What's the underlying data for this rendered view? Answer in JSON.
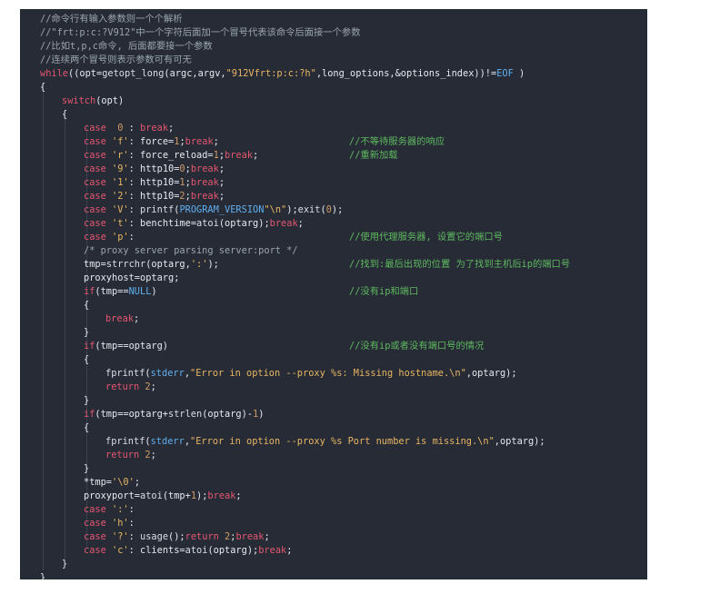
{
  "lines": [
    {
      "indent": 0,
      "tokens": [
        {
          "t": "//命令行有输入参数则一个个解析",
          "c": "cmt"
        }
      ]
    },
    {
      "indent": 0,
      "tokens": [
        {
          "t": "//\"frt:p:c:?V912\"中一个字符后面加一个冒号代表该命令后面接一个参数",
          "c": "cmt"
        }
      ]
    },
    {
      "indent": 0,
      "tokens": [
        {
          "t": "//比如t,p,c命令, 后面都要接一个参数",
          "c": "cmt"
        }
      ]
    },
    {
      "indent": 0,
      "tokens": [
        {
          "t": "//连续两个冒号则表示参数可有可无",
          "c": "cmt"
        }
      ]
    },
    {
      "indent": 0,
      "tokens": [
        {
          "t": "while",
          "c": "kw"
        },
        {
          "t": "((opt=",
          "c": "id"
        },
        {
          "t": "getopt_long",
          "c": "fn"
        },
        {
          "t": "(argc,argv,",
          "c": "id"
        },
        {
          "t": "\"912Vfrt:p:c:?h\"",
          "c": "str"
        },
        {
          "t": ",long_options,&options_index))!=",
          "c": "id"
        },
        {
          "t": "EOF",
          "c": "blu"
        },
        {
          "t": " )",
          "c": "id"
        }
      ]
    },
    {
      "indent": 0,
      "tokens": [
        {
          "t": "{",
          "c": "id"
        }
      ]
    },
    {
      "indent": 1,
      "tokens": [
        {
          "t": "switch",
          "c": "kw"
        },
        {
          "t": "(opt)",
          "c": "id"
        }
      ]
    },
    {
      "indent": 1,
      "tokens": [
        {
          "t": "{",
          "c": "id"
        }
      ]
    },
    {
      "indent": 2,
      "tokens": [
        {
          "t": "case",
          "c": "kw"
        },
        {
          "t": "  ",
          "c": "id"
        },
        {
          "t": "0",
          "c": "num"
        },
        {
          "t": " : ",
          "c": "id"
        },
        {
          "t": "break",
          "c": "kw"
        },
        {
          "t": ";",
          "c": "id"
        }
      ]
    },
    {
      "indent": 2,
      "tokens": [
        {
          "t": "case",
          "c": "kw"
        },
        {
          "t": " ",
          "c": "id"
        },
        {
          "t": "'f'",
          "c": "str"
        },
        {
          "t": ": force=",
          "c": "id"
        },
        {
          "t": "1",
          "c": "num"
        },
        {
          "t": ";",
          "c": "id"
        },
        {
          "t": "break",
          "c": "kw"
        },
        {
          "t": ";",
          "c": "id"
        }
      ],
      "comment": "//不等待服务器的响应"
    },
    {
      "indent": 2,
      "tokens": [
        {
          "t": "case",
          "c": "kw"
        },
        {
          "t": " ",
          "c": "id"
        },
        {
          "t": "'r'",
          "c": "str"
        },
        {
          "t": ": force_reload=",
          "c": "id"
        },
        {
          "t": "1",
          "c": "num"
        },
        {
          "t": ";",
          "c": "id"
        },
        {
          "t": "break",
          "c": "kw"
        },
        {
          "t": ";",
          "c": "id"
        }
      ],
      "comment": "//重新加载"
    },
    {
      "indent": 2,
      "tokens": [
        {
          "t": "case",
          "c": "kw"
        },
        {
          "t": " ",
          "c": "id"
        },
        {
          "t": "'9'",
          "c": "str"
        },
        {
          "t": ": http10=",
          "c": "id"
        },
        {
          "t": "0",
          "c": "num"
        },
        {
          "t": ";",
          "c": "id"
        },
        {
          "t": "break",
          "c": "kw"
        },
        {
          "t": ";",
          "c": "id"
        }
      ]
    },
    {
      "indent": 2,
      "tokens": [
        {
          "t": "case",
          "c": "kw"
        },
        {
          "t": " ",
          "c": "id"
        },
        {
          "t": "'1'",
          "c": "str"
        },
        {
          "t": ": http10=",
          "c": "id"
        },
        {
          "t": "1",
          "c": "num"
        },
        {
          "t": ";",
          "c": "id"
        },
        {
          "t": "break",
          "c": "kw"
        },
        {
          "t": ";",
          "c": "id"
        }
      ]
    },
    {
      "indent": 2,
      "tokens": [
        {
          "t": "case",
          "c": "kw"
        },
        {
          "t": " ",
          "c": "id"
        },
        {
          "t": "'2'",
          "c": "str"
        },
        {
          "t": ": http10=",
          "c": "id"
        },
        {
          "t": "2",
          "c": "num"
        },
        {
          "t": ";",
          "c": "id"
        },
        {
          "t": "break",
          "c": "kw"
        },
        {
          "t": ";",
          "c": "id"
        }
      ]
    },
    {
      "indent": 2,
      "tokens": [
        {
          "t": "case",
          "c": "kw"
        },
        {
          "t": " ",
          "c": "id"
        },
        {
          "t": "'V'",
          "c": "str"
        },
        {
          "t": ": ",
          "c": "id"
        },
        {
          "t": "printf",
          "c": "fn"
        },
        {
          "t": "(",
          "c": "id"
        },
        {
          "t": "PROGRAM_VERSION",
          "c": "blu"
        },
        {
          "t": "\"\\n\"",
          "c": "str"
        },
        {
          "t": ");",
          "c": "id"
        },
        {
          "t": "exit",
          "c": "fn"
        },
        {
          "t": "(",
          "c": "id"
        },
        {
          "t": "0",
          "c": "num"
        },
        {
          "t": ");",
          "c": "id"
        }
      ]
    },
    {
      "indent": 2,
      "tokens": [
        {
          "t": "case",
          "c": "kw"
        },
        {
          "t": " ",
          "c": "id"
        },
        {
          "t": "'t'",
          "c": "str"
        },
        {
          "t": ": benchtime=",
          "c": "id"
        },
        {
          "t": "atoi",
          "c": "fn"
        },
        {
          "t": "(optarg);",
          "c": "id"
        },
        {
          "t": "break",
          "c": "kw"
        },
        {
          "t": ";",
          "c": "id"
        }
      ]
    },
    {
      "indent": 2,
      "tokens": [
        {
          "t": "case",
          "c": "kw"
        },
        {
          "t": " ",
          "c": "id"
        },
        {
          "t": "'p'",
          "c": "str"
        },
        {
          "t": ":",
          "c": "id"
        }
      ],
      "comment": "//使用代理服务器, 设置它的端口号"
    },
    {
      "indent": 2,
      "tokens": [
        {
          "t": "/* proxy server parsing server:port */",
          "c": "cmt"
        }
      ]
    },
    {
      "indent": 2,
      "tokens": [
        {
          "t": "tmp=",
          "c": "id"
        },
        {
          "t": "strrchr",
          "c": "fn"
        },
        {
          "t": "(optarg,",
          "c": "id"
        },
        {
          "t": "':'",
          "c": "str"
        },
        {
          "t": ");",
          "c": "id"
        }
      ],
      "comment": "//找到:最后出现的位置 为了找到主机后ip的端口号"
    },
    {
      "indent": 2,
      "tokens": [
        {
          "t": "proxyhost=optarg;",
          "c": "id"
        }
      ]
    },
    {
      "indent": 2,
      "tokens": [
        {
          "t": "if",
          "c": "kw"
        },
        {
          "t": "(tmp==",
          "c": "id"
        },
        {
          "t": "NULL",
          "c": "blu"
        },
        {
          "t": ")",
          "c": "id"
        }
      ],
      "comment": "//没有ip和端口"
    },
    {
      "indent": 2,
      "tokens": [
        {
          "t": "{",
          "c": "id"
        }
      ]
    },
    {
      "indent": 3,
      "tokens": [
        {
          "t": "break",
          "c": "kw"
        },
        {
          "t": ";",
          "c": "id"
        }
      ]
    },
    {
      "indent": 2,
      "tokens": [
        {
          "t": "}",
          "c": "id"
        }
      ]
    },
    {
      "indent": 2,
      "tokens": [
        {
          "t": "if",
          "c": "kw"
        },
        {
          "t": "(tmp==optarg)",
          "c": "id"
        }
      ],
      "comment": "//没有ip或者没有端口号的情况"
    },
    {
      "indent": 2,
      "tokens": [
        {
          "t": "{",
          "c": "id"
        }
      ]
    },
    {
      "indent": 3,
      "tokens": [
        {
          "t": "fprintf",
          "c": "fn"
        },
        {
          "t": "(",
          "c": "id"
        },
        {
          "t": "stderr",
          "c": "blu"
        },
        {
          "t": ",",
          "c": "id"
        },
        {
          "t": "\"Error in option --proxy %s: Missing hostname.\\n\"",
          "c": "str"
        },
        {
          "t": ",optarg);",
          "c": "id"
        }
      ]
    },
    {
      "indent": 3,
      "tokens": [
        {
          "t": "return",
          "c": "kw"
        },
        {
          "t": " ",
          "c": "id"
        },
        {
          "t": "2",
          "c": "num"
        },
        {
          "t": ";",
          "c": "id"
        }
      ]
    },
    {
      "indent": 2,
      "tokens": [
        {
          "t": "}",
          "c": "id"
        }
      ]
    },
    {
      "indent": 2,
      "tokens": [
        {
          "t": "if",
          "c": "kw"
        },
        {
          "t": "(tmp==optarg+",
          "c": "id"
        },
        {
          "t": "strlen",
          "c": "fn"
        },
        {
          "t": "(optarg)-",
          "c": "id"
        },
        {
          "t": "1",
          "c": "num"
        },
        {
          "t": ")",
          "c": "id"
        }
      ]
    },
    {
      "indent": 2,
      "tokens": [
        {
          "t": "{",
          "c": "id"
        }
      ]
    },
    {
      "indent": 3,
      "tokens": [
        {
          "t": "fprintf",
          "c": "fn"
        },
        {
          "t": "(",
          "c": "id"
        },
        {
          "t": "stderr",
          "c": "blu"
        },
        {
          "t": ",",
          "c": "id"
        },
        {
          "t": "\"Error in option --proxy %s Port number is missing.\\n\"",
          "c": "str"
        },
        {
          "t": ",optarg);",
          "c": "id"
        }
      ]
    },
    {
      "indent": 3,
      "tokens": [
        {
          "t": "return",
          "c": "kw"
        },
        {
          "t": " ",
          "c": "id"
        },
        {
          "t": "2",
          "c": "num"
        },
        {
          "t": ";",
          "c": "id"
        }
      ]
    },
    {
      "indent": 2,
      "tokens": [
        {
          "t": "}",
          "c": "id"
        }
      ]
    },
    {
      "indent": 2,
      "tokens": [
        {
          "t": "*tmp=",
          "c": "id"
        },
        {
          "t": "'\\0'",
          "c": "str"
        },
        {
          "t": ";",
          "c": "id"
        }
      ]
    },
    {
      "indent": 2,
      "tokens": [
        {
          "t": "proxyport=",
          "c": "id"
        },
        {
          "t": "atoi",
          "c": "fn"
        },
        {
          "t": "(tmp+",
          "c": "id"
        },
        {
          "t": "1",
          "c": "num"
        },
        {
          "t": ");",
          "c": "id"
        },
        {
          "t": "break",
          "c": "kw"
        },
        {
          "t": ";",
          "c": "id"
        }
      ]
    },
    {
      "indent": 2,
      "tokens": [
        {
          "t": "case",
          "c": "kw"
        },
        {
          "t": " ",
          "c": "id"
        },
        {
          "t": "':'",
          "c": "str"
        },
        {
          "t": ":",
          "c": "id"
        }
      ]
    },
    {
      "indent": 2,
      "tokens": [
        {
          "t": "case",
          "c": "kw"
        },
        {
          "t": " ",
          "c": "id"
        },
        {
          "t": "'h'",
          "c": "str"
        },
        {
          "t": ":",
          "c": "id"
        }
      ]
    },
    {
      "indent": 2,
      "tokens": [
        {
          "t": "case",
          "c": "kw"
        },
        {
          "t": " ",
          "c": "id"
        },
        {
          "t": "'?'",
          "c": "str"
        },
        {
          "t": ": ",
          "c": "id"
        },
        {
          "t": "usage",
          "c": "fn"
        },
        {
          "t": "();",
          "c": "id"
        },
        {
          "t": "return",
          "c": "kw"
        },
        {
          "t": " ",
          "c": "id"
        },
        {
          "t": "2",
          "c": "num"
        },
        {
          "t": ";",
          "c": "id"
        },
        {
          "t": "break",
          "c": "kw"
        },
        {
          "t": ";",
          "c": "id"
        }
      ]
    },
    {
      "indent": 2,
      "tokens": [
        {
          "t": "case",
          "c": "kw"
        },
        {
          "t": " ",
          "c": "id"
        },
        {
          "t": "'c'",
          "c": "str"
        },
        {
          "t": ": clients=",
          "c": "id"
        },
        {
          "t": "atoi",
          "c": "fn"
        },
        {
          "t": "(optarg);",
          "c": "id"
        },
        {
          "t": "break",
          "c": "kw"
        },
        {
          "t": ";",
          "c": "id"
        }
      ]
    },
    {
      "indent": 1,
      "tokens": [
        {
          "t": "}",
          "c": "id"
        }
      ]
    },
    {
      "indent": 0,
      "tokens": [
        {
          "t": "}",
          "c": "id"
        }
      ]
    }
  ]
}
